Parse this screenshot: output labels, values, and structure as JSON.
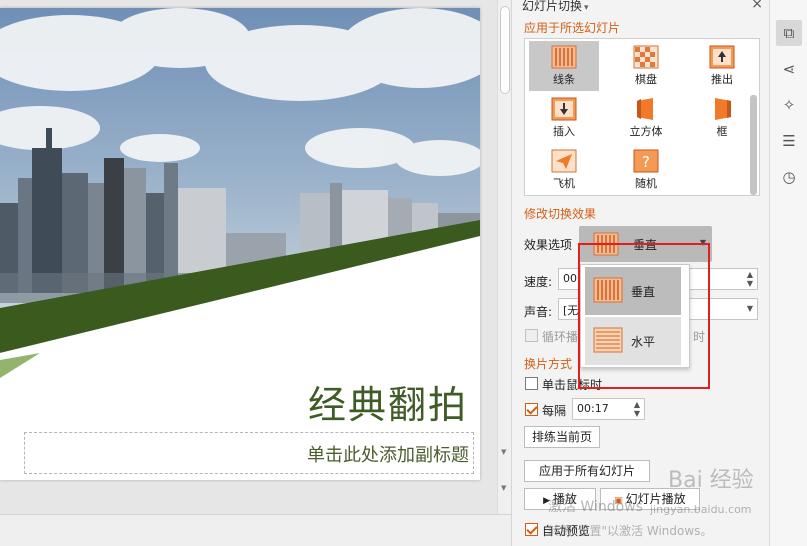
{
  "slide": {
    "title": "经典翻拍",
    "subtitle_placeholder": "单击此处添加副标题"
  },
  "panel": {
    "header": "幻灯片切换",
    "header_caret": "▾",
    "close_glyph": "×",
    "apply_section_title": "应用于所选幻灯片",
    "transitions": [
      {
        "label": "线条",
        "icon": "lines-transition-icon"
      },
      {
        "label": "棋盘",
        "icon": "checkerboard-transition-icon"
      },
      {
        "label": "推出",
        "icon": "push-transition-icon"
      },
      {
        "label": "插入",
        "icon": "cover-transition-icon"
      },
      {
        "label": "立方体",
        "icon": "cube-transition-icon"
      },
      {
        "label": "框",
        "icon": "box-transition-icon"
      },
      {
        "label": "飞机",
        "icon": "airplane-transition-icon"
      },
      {
        "label": "随机",
        "icon": "random-transition-icon"
      }
    ],
    "modify_section_title": "修改切换效果",
    "effect_label": "效果选项",
    "effect_value": "垂直",
    "speed_label": "速度:",
    "speed_value": "00",
    "sound_label": "声音:",
    "sound_value": "[无",
    "loop_label": "循环播",
    "loop_suffix": "时",
    "advance_section_title": "换片方式",
    "on_click_label": "单击鼠标时",
    "on_click_checked": false,
    "every_label": "每隔",
    "every_checked": true,
    "every_value": "00:17",
    "rehearse_button": "排练当前页",
    "apply_all_button": "应用于所有幻灯片",
    "play_button": "播放",
    "slideshow_button": "幻灯片播放",
    "auto_preview_label": "自动预览",
    "auto_preview_checked": true
  },
  "dropdown": {
    "options": [
      {
        "label": "垂直",
        "icon": "vertical-stripes-icon",
        "selected": true
      },
      {
        "label": "水平",
        "icon": "horizontal-stripes-icon",
        "selected": false
      }
    ]
  },
  "watermarks": {
    "activate_line1": "激活 Windows",
    "activate_line2": "转到\"设置\"以激活 Windows。",
    "site_brand": "Bai 经验",
    "site_url": "jingyan.baidu.com"
  },
  "colors": {
    "accent": "#d35f14",
    "title_green": "#3f5b26",
    "band_green": "#3a5a1e",
    "highlight_red": "#e02020"
  }
}
